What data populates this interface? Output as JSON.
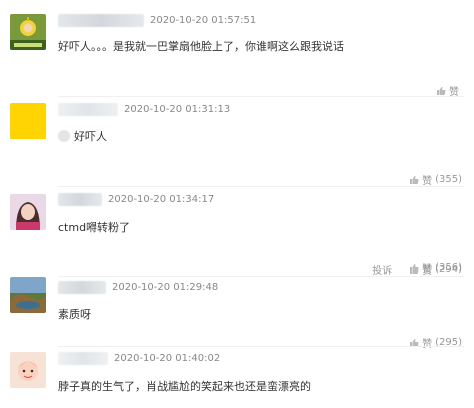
{
  "comments": [
    {
      "time": "2020-10-20 01:57:51",
      "text": "好吓人。。。是我就一巴掌扇他脸上了，你谁啊这么跟我说话",
      "like_label": "赞",
      "like_count": "",
      "avatar": "teletubby-avatar"
    },
    {
      "time": "2020-10-20 01:31:13",
      "text": "好吓人",
      "like_label": "赞",
      "like_count": "(355)",
      "avatar": "yellow-avatar"
    },
    {
      "time": "2020-10-20 01:34:17",
      "text": "ctmd嘚转粉了",
      "like_label": "赞",
      "like_count": "(356)",
      "avatar": "girl-avatar"
    },
    {
      "time": "2020-10-20 01:29:48",
      "text": "素质呀",
      "report_label": "投诉",
      "like_label": "赞",
      "like_count": "(294)",
      "avatar": "landscape-avatar"
    },
    {
      "time": "2020-10-20 01:40:02",
      "text": "脖子真的生气了，肖战尴尬的笑起来也还是蛮漂亮的",
      "like_label": "赞",
      "like_count": "(295)",
      "avatar": "cartoon-avatar"
    }
  ],
  "colors": {
    "meta_text": "#888888",
    "body_text": "#333333",
    "action_text": "#999999",
    "yellow_avatar": "#ffd400"
  }
}
